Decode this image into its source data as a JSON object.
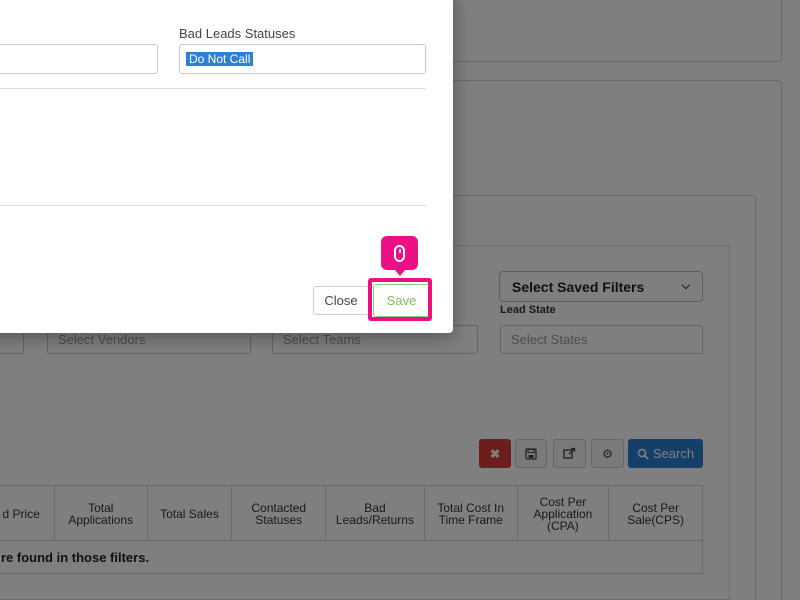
{
  "modal": {
    "bad_leads_statuses_label": "Bad Leads Statuses",
    "bad_leads_statuses_value": "Do Not Call",
    "close_label": "Close",
    "save_label": "Save"
  },
  "filters": {
    "saved_filters_label": "Select Saved Filters",
    "lead_state_label": "Lead State",
    "vendors_placeholder": "Select Vendors",
    "teams_placeholder": "Select Teams",
    "states_placeholder": "Select States"
  },
  "toolbar": {
    "search_label": "Search"
  },
  "table": {
    "columns": [
      "d Price",
      "Total Applications",
      "Total Sales",
      "Contacted Statuses",
      "Bad Leads/Returns",
      "Total Cost In Time Frame",
      "Cost Per Application (CPA)",
      "Cost Per Sale(CPS)"
    ],
    "empty_message": "re found in those filters."
  },
  "colors": {
    "highlight": "#ee0f86",
    "search_button": "#2a7fd1",
    "clear_button": "#dc3b3b",
    "save_button_text": "#7dbe5b"
  },
  "icons": {
    "clear": "x-icon",
    "save_filter": "floppy-disk-icon",
    "export": "external-link-icon",
    "settings": "gear-icon",
    "search": "search-icon",
    "click": "mouse-icon"
  }
}
